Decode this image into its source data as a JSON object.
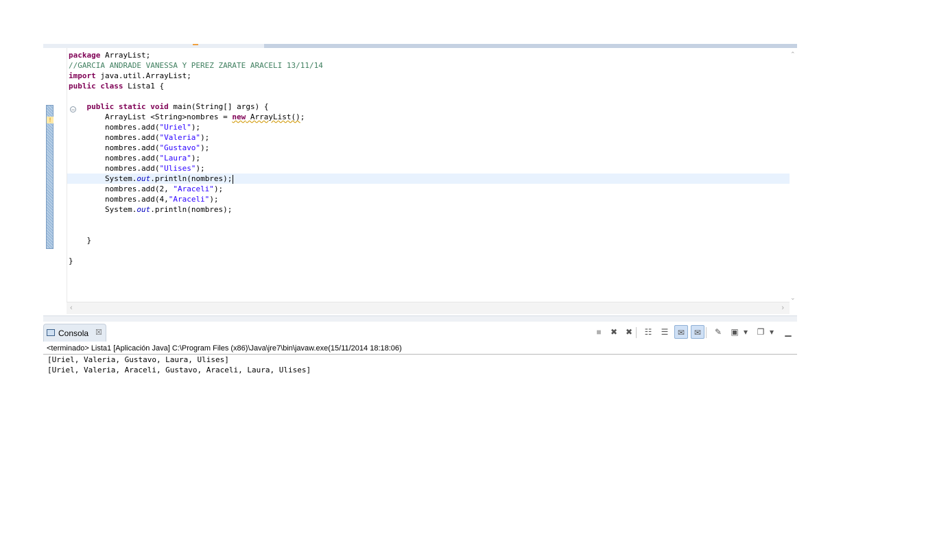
{
  "editor": {
    "code_lines": [
      [
        {
          "t": "package",
          "c": "kw"
        },
        {
          "t": " ArrayList;"
        }
      ],
      [
        {
          "t": "//GARCIA ANDRADE VANESSA Y PEREZ ZARATE ARACELI 13/11/14",
          "c": "cm"
        }
      ],
      [
        {
          "t": "import",
          "c": "kw"
        },
        {
          "t": " java.util.ArrayList;"
        }
      ],
      [
        {
          "t": "public",
          "c": "kw"
        },
        {
          "t": " "
        },
        {
          "t": "class",
          "c": "kw"
        },
        {
          "t": " Lista1 {"
        }
      ],
      [],
      [
        {
          "t": "    "
        },
        {
          "t": "public",
          "c": "kw"
        },
        {
          "t": " "
        },
        {
          "t": "static",
          "c": "kw"
        },
        {
          "t": " "
        },
        {
          "t": "void",
          "c": "kw"
        },
        {
          "t": " main(String[] args) {"
        }
      ],
      [
        {
          "t": "        ArrayList <String>nombres = "
        },
        {
          "t": "new",
          "c": "kw warn-underline"
        },
        {
          "t": " ArrayList()",
          "c": "warn-underline"
        },
        {
          "t": ";"
        }
      ],
      [
        {
          "t": "        nombres.add("
        },
        {
          "t": "\"Uriel\"",
          "c": "str"
        },
        {
          "t": ");"
        }
      ],
      [
        {
          "t": "        nombres.add("
        },
        {
          "t": "\"Valeria\"",
          "c": "str"
        },
        {
          "t": ");"
        }
      ],
      [
        {
          "t": "        nombres.add("
        },
        {
          "t": "\"Gustavo\"",
          "c": "str"
        },
        {
          "t": ");"
        }
      ],
      [
        {
          "t": "        nombres.add("
        },
        {
          "t": "\"Laura\"",
          "c": "str"
        },
        {
          "t": ");"
        }
      ],
      [
        {
          "t": "        nombres.add("
        },
        {
          "t": "\"Ulises\"",
          "c": "str"
        },
        {
          "t": ");"
        }
      ],
      [
        {
          "t": "        System."
        },
        {
          "t": "out",
          "c": "fld"
        },
        {
          "t": ".println(nombres);"
        },
        {
          "caret": true
        }
      ],
      [
        {
          "t": "        nombres.add(2, "
        },
        {
          "t": "\"Araceli\"",
          "c": "str"
        },
        {
          "t": ");"
        }
      ],
      [
        {
          "t": "        nombres.add(4,"
        },
        {
          "t": "\"Araceli\"",
          "c": "str"
        },
        {
          "t": ");"
        }
      ],
      [
        {
          "t": "        System."
        },
        {
          "t": "out",
          "c": "fld"
        },
        {
          "t": ".println(nombres);"
        }
      ],
      [],
      [],
      [
        {
          "t": "    }"
        }
      ],
      [],
      [
        {
          "t": "}"
        }
      ]
    ],
    "current_line_index": 12
  },
  "console": {
    "tab_label": "Consola",
    "tab_close_glyph": "☒",
    "description": "<terminado> Lista1 [Aplicación Java] C:\\Program Files (x86)\\Java\\jre7\\bin\\javaw.exe(15/11/2014 18:18:06)",
    "output": [
      "[Uriel, Valeria, Gustavo, Laura, Ulises]",
      "[Uriel, Valeria, Araceli, Gustavo, Araceli, Laura, Ulises]"
    ]
  },
  "toolbar": {
    "buttons": [
      {
        "name": "terminate-icon",
        "glyph": "■",
        "active": false
      },
      {
        "name": "remove-launch-icon",
        "glyph": "✖",
        "active": false
      },
      {
        "name": "remove-all-launches-icon",
        "glyph": "✖",
        "active": false
      },
      {
        "name": "clear-console-icon",
        "glyph": "☷",
        "active": false
      },
      {
        "name": "scroll-lock-icon",
        "glyph": "☰",
        "active": false
      },
      {
        "name": "show-on-stdout-icon",
        "glyph": "✉",
        "active": true
      },
      {
        "name": "show-on-stderr-icon",
        "glyph": "✉",
        "active": true
      },
      {
        "name": "pin-console-icon",
        "glyph": "✎",
        "active": false
      },
      {
        "name": "display-console-icon",
        "glyph": "▣",
        "active": false
      },
      {
        "name": "display-dropdown-icon",
        "glyph": "▾",
        "active": false
      },
      {
        "name": "open-console-icon",
        "glyph": "❐",
        "active": false
      },
      {
        "name": "open-dropdown-icon",
        "glyph": "▾",
        "active": false
      },
      {
        "name": "minimize-icon",
        "glyph": "▁",
        "active": false
      }
    ]
  },
  "colors": {
    "keyword": "#7f0055",
    "comment": "#3f7f5f",
    "string": "#2a00ff",
    "field": "#0000c0",
    "current_line": "#e8f2fe"
  }
}
